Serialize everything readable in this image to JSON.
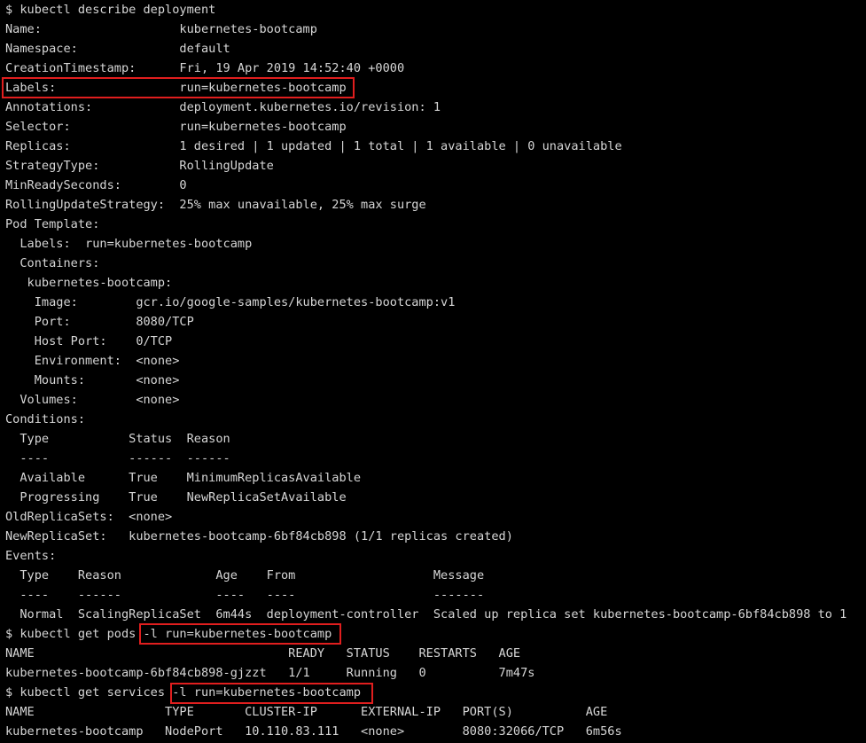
{
  "colors": {
    "background": "#000000",
    "text": "#d6d6d6",
    "highlight": "#e01e1e"
  },
  "lines": [
    "$ kubectl describe deployment",
    "Name:                   kubernetes-bootcamp",
    "Namespace:              default",
    "CreationTimestamp:      Fri, 19 Apr 2019 14:52:40 +0000",
    "Labels:                 run=kubernetes-bootcamp",
    "Annotations:            deployment.kubernetes.io/revision: 1",
    "Selector:               run=kubernetes-bootcamp",
    "Replicas:               1 desired | 1 updated | 1 total | 1 available | 0 unavailable",
    "StrategyType:           RollingUpdate",
    "MinReadySeconds:        0",
    "RollingUpdateStrategy:  25% max unavailable, 25% max surge",
    "Pod Template:",
    "  Labels:  run=kubernetes-bootcamp",
    "  Containers:",
    "   kubernetes-bootcamp:",
    "    Image:        gcr.io/google-samples/kubernetes-bootcamp:v1",
    "    Port:         8080/TCP",
    "    Host Port:    0/TCP",
    "    Environment:  <none>",
    "    Mounts:       <none>",
    "  Volumes:        <none>",
    "Conditions:",
    "  Type           Status  Reason",
    "  ----           ------  ------",
    "  Available      True    MinimumReplicasAvailable",
    "  Progressing    True    NewReplicaSetAvailable",
    "OldReplicaSets:  <none>",
    "NewReplicaSet:   kubernetes-bootcamp-6bf84cb898 (1/1 replicas created)",
    "Events:",
    "  Type    Reason             Age    From                   Message",
    "  ----    ------             ----   ----                   -------",
    "  Normal  ScalingReplicaSet  6m44s  deployment-controller  Scaled up replica set kubernetes-bootcamp-6bf84cb898 to 1",
    "$ kubectl get pods -l run=kubernetes-bootcamp",
    "NAME                                   READY   STATUS    RESTARTS   AGE",
    "kubernetes-bootcamp-6bf84cb898-gjzzt   1/1     Running   0          7m47s",
    "$ kubectl get services -l run=kubernetes-bootcamp",
    "NAME                  TYPE       CLUSTER-IP      EXTERNAL-IP   PORT(S)          AGE",
    "kubernetes-bootcamp   NodePort   10.110.83.111   <none>        8080:32066/TCP   6m56s"
  ]
}
